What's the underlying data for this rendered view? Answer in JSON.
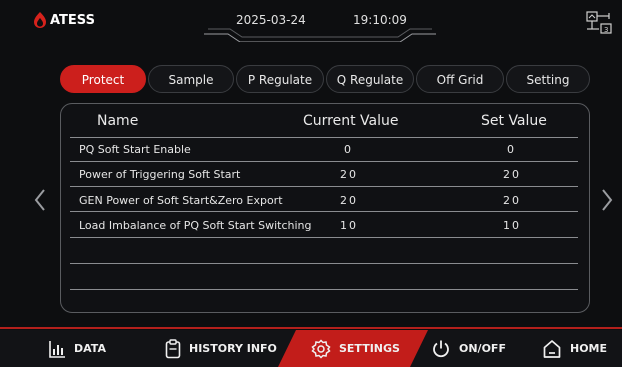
{
  "brand": {
    "name": "ATESS"
  },
  "status": {
    "date": "2025-03-24",
    "time": "19:10:09"
  },
  "tabs": [
    {
      "label": "Protect",
      "active": true
    },
    {
      "label": "Sample",
      "active": false
    },
    {
      "label": "P Regulate",
      "active": false
    },
    {
      "label": "Q Regulate",
      "active": false
    },
    {
      "label": "Off Grid",
      "active": false
    },
    {
      "label": "Setting",
      "active": false
    }
  ],
  "table": {
    "columns": [
      "Name",
      "Current Value",
      "Set Value"
    ],
    "rows": [
      {
        "name": "PQ Soft Start Enable",
        "current": "0",
        "set": "0"
      },
      {
        "name": "Power of Triggering Soft Start",
        "current": "20",
        "set": "20"
      },
      {
        "name": "GEN Power of Soft Start&Zero Export",
        "current": "20",
        "set": "20"
      },
      {
        "name": "Load Imbalance of PQ Soft Start Switching",
        "current": "10",
        "set": "10"
      }
    ]
  },
  "bottom_nav": [
    {
      "label": "DATA",
      "icon": "bar-chart-icon"
    },
    {
      "label": "HISTORY INFO",
      "icon": "clipboard-icon"
    },
    {
      "label": "SETTINGS",
      "icon": "gear-icon",
      "active": true
    },
    {
      "label": "ON/OFF",
      "icon": "power-icon"
    },
    {
      "label": "HOME",
      "icon": "home-icon"
    }
  ],
  "colors": {
    "accent": "#cc1f1c",
    "background": "#0d0e10"
  }
}
